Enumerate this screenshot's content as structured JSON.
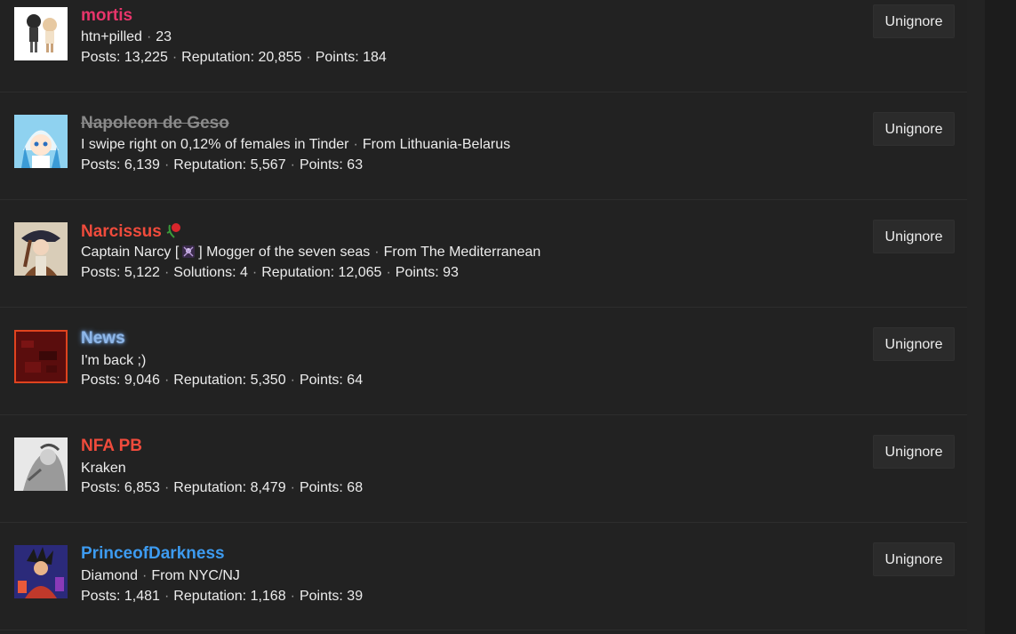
{
  "ignore_button_label": "Unignore",
  "users": [
    {
      "name": "mortis",
      "name_color": "#e8356b",
      "strike": false,
      "glow": false,
      "title": "htn+pilled",
      "title_meta": "23",
      "posts": "Posts: 13,225",
      "solutions": "",
      "reputation": "Reputation: 20,855",
      "points": "Points: 184",
      "avatar_icon": "anime-couple-avatar"
    },
    {
      "name": "Napoleon de Geso",
      "name_color": "#8a8a8a",
      "strike": true,
      "glow": false,
      "title": "I swipe right on 0,12% of females in Tinder",
      "title_meta": "From Lithuania-Belarus",
      "posts": "Posts: 6,139",
      "solutions": "",
      "reputation": "Reputation: 5,567",
      "points": "Points: 63",
      "avatar_icon": "squid-girl-avatar"
    },
    {
      "name": "Narcissus",
      "name_color": "#f04b3c",
      "strike": false,
      "glow": false,
      "title_prefix": "Captain Narcy [",
      "title_emoji": "skull-crossbones-icon",
      "title_suffix": "] Mogger of the seven seas",
      "title_meta": "From The Mediterranean",
      "posts": "Posts: 5,122",
      "solutions": "Solutions: 4",
      "reputation": "Reputation: 12,065",
      "points": "Points: 93",
      "avatar_icon": "pirate-captain-avatar",
      "badge_icon": "wilted-rose-icon"
    },
    {
      "name": "News",
      "name_color": "#8fb7e8",
      "strike": false,
      "glow": true,
      "title": "I'm back ;)",
      "title_meta": "",
      "posts": "Posts: 9,046",
      "solutions": "",
      "reputation": "Reputation: 5,350",
      "points": "Points: 64",
      "avatar_icon": "red-noise-avatar"
    },
    {
      "name": "NFA PB",
      "name_color": "#f04b3c",
      "strike": false,
      "glow": false,
      "title": "Kraken",
      "title_meta": "",
      "posts": "Posts: 6,853",
      "solutions": "",
      "reputation": "Reputation: 8,479",
      "points": "Points: 68",
      "avatar_icon": "grayscale-sketch-avatar"
    },
    {
      "name": "PrinceofDarkness",
      "name_color": "#3d9bf0",
      "strike": false,
      "glow": false,
      "title": "Diamond",
      "title_meta": "From NYC/NJ",
      "posts": "Posts: 1,481",
      "solutions": "",
      "reputation": "Reputation: 1,168",
      "points": "Points: 39",
      "avatar_icon": "fighter-character-avatar"
    }
  ]
}
